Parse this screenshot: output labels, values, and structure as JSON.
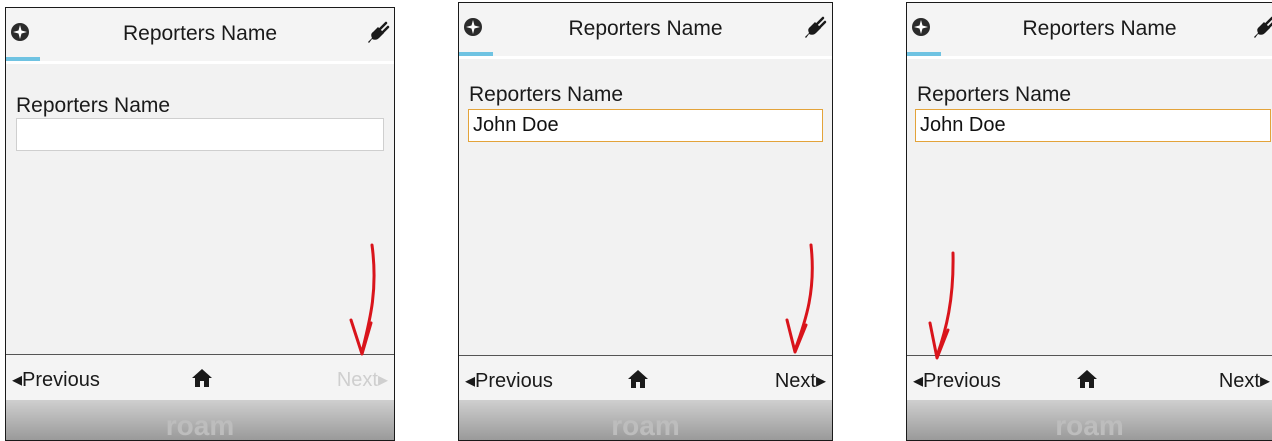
{
  "screens": [
    {
      "title": "Reporters Name",
      "field_label": "Reporters Name",
      "field_value": "",
      "prev_label": "Previous",
      "next_label": "Next",
      "next_enabled": false,
      "brand": "roam"
    },
    {
      "title": "Reporters Name",
      "field_label": "Reporters Name",
      "field_value": "John Doe",
      "prev_label": "Previous",
      "next_label": "Next",
      "next_enabled": true,
      "brand": "roam"
    },
    {
      "title": "Reporters Name",
      "field_label": "Reporters Name",
      "field_value": "John Doe",
      "prev_label": "Previous",
      "next_label": "Next",
      "next_enabled": true,
      "brand": "roam"
    }
  ],
  "icons": {
    "top_left": "compass-icon",
    "top_right": "plug-icon",
    "nav_center": "home-icon"
  },
  "colors": {
    "progress": "#6fc3e2",
    "field_focus_border": "#e3a33a",
    "annotation_arrow": "#d9141b"
  }
}
